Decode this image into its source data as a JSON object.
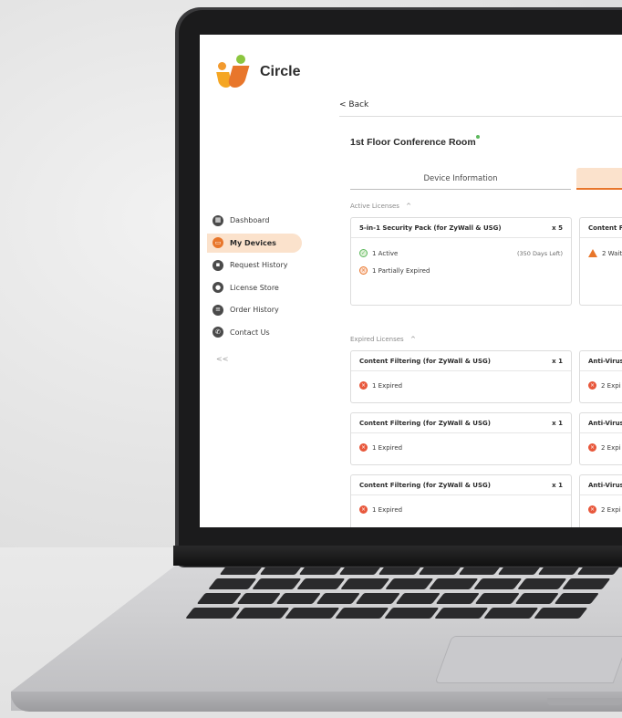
{
  "app": {
    "name": "Circle",
    "colors": {
      "accent": "#e8762b",
      "accent_light": "#fbe2cc",
      "ok": "#5cb85c",
      "error": "#e8573b"
    }
  },
  "sidebar": {
    "items": [
      {
        "label": "Dashboard",
        "icon": "dashboard-icon",
        "active": false
      },
      {
        "label": "My Devices",
        "icon": "devices-icon",
        "active": true
      },
      {
        "label": "Request History",
        "icon": "lock-icon",
        "active": false
      },
      {
        "label": "License Store",
        "icon": "store-icon",
        "active": false
      },
      {
        "label": "Order History",
        "icon": "list-icon",
        "active": false
      },
      {
        "label": "Contact Us",
        "icon": "contact-icon",
        "active": false
      }
    ],
    "collapse_label": "<<"
  },
  "main": {
    "back_label": "Back",
    "back_icon": "<",
    "device_title": "1st Floor Conference Room",
    "tabs": [
      {
        "label": "Device Information"
      }
    ],
    "active_section": {
      "label": "Active Licenses",
      "caret": "^",
      "cards": [
        {
          "name": "5-in-1 Security Pack (for ZyWall & USG)",
          "qty": "x 5",
          "statuses": [
            {
              "icon": "check-icon",
              "glyph": "✓",
              "text": "1 Active",
              "note": "(350 Days Left)"
            },
            {
              "icon": "partial-icon",
              "glyph": "×",
              "text": "1 Partially Expired",
              "note": ""
            }
          ]
        },
        {
          "name": "Content F",
          "qty": "",
          "statuses": [
            {
              "icon": "warning-icon",
              "glyph": "!",
              "text": "2 Wait",
              "note": ""
            }
          ]
        }
      ]
    },
    "expired_section": {
      "label": "Expired Licenses",
      "caret": "^",
      "rows": [
        {
          "left": {
            "name": "Content Filtering (for ZyWall & USG)",
            "qty": "x 1",
            "status": "1 Expired",
            "glyph": "×"
          },
          "right": {
            "name": "Anti-Virus",
            "status": "2 Expi",
            "glyph": "×"
          }
        },
        {
          "left": {
            "name": "Content Filtering (for ZyWall & USG)",
            "qty": "x 1",
            "status": "1 Expired",
            "glyph": "×"
          },
          "right": {
            "name": "Anti-Virus",
            "status": "2 Expi",
            "glyph": "×"
          }
        },
        {
          "left": {
            "name": "Content Filtering (for ZyWall & USG)",
            "qty": "x 1",
            "status": "1 Expired",
            "glyph": "×"
          },
          "right": {
            "name": "Anti-Virus",
            "status": "2 Expi",
            "glyph": "×"
          }
        }
      ]
    }
  }
}
